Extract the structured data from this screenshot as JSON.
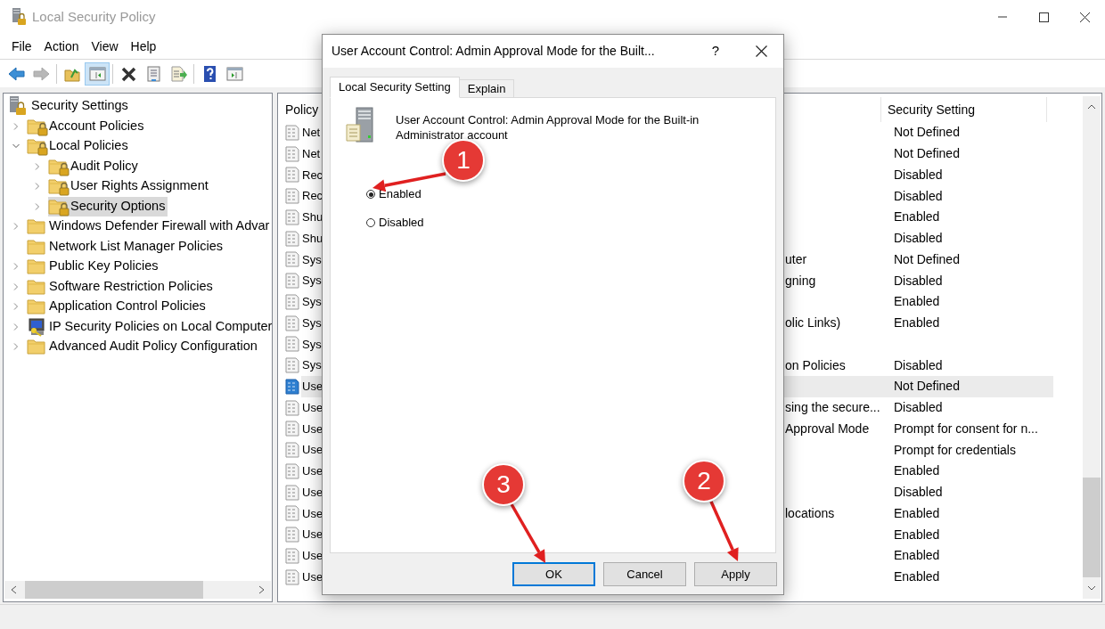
{
  "window": {
    "title": "Local Security Policy"
  },
  "menu": [
    "File",
    "Action",
    "View",
    "Help"
  ],
  "toolbar": [
    {
      "kind": "back",
      "disabled": false,
      "pressed": false
    },
    {
      "kind": "forward",
      "disabled": true,
      "pressed": false
    },
    {
      "kind": "separator"
    },
    {
      "kind": "up",
      "disabled": false,
      "pressed": false
    },
    {
      "kind": "console-tree",
      "disabled": false,
      "pressed": true
    },
    {
      "kind": "separator"
    },
    {
      "kind": "delete",
      "disabled": false,
      "pressed": false
    },
    {
      "kind": "properties",
      "disabled": false,
      "pressed": false
    },
    {
      "kind": "export",
      "disabled": false,
      "pressed": false
    },
    {
      "kind": "separator"
    },
    {
      "kind": "help",
      "disabled": false,
      "pressed": false
    },
    {
      "kind": "action-pane",
      "disabled": false,
      "pressed": false
    }
  ],
  "tree": {
    "label": "Security Settings",
    "children": [
      {
        "label": "Account Policies",
        "kind": "locked-folder",
        "expanded": false,
        "selected": false
      },
      {
        "label": "Local Policies",
        "kind": "locked-folder",
        "expanded": true,
        "selected": false,
        "children": [
          {
            "label": "Audit Policy",
            "kind": "locked-folder",
            "expanded": false,
            "selected": false
          },
          {
            "label": "User Rights Assignment",
            "kind": "locked-folder",
            "expanded": false,
            "selected": false
          },
          {
            "label": "Security Options",
            "kind": "locked-folder",
            "expanded": false,
            "selected": true
          }
        ]
      },
      {
        "label": "Windows Defender Firewall with Advar",
        "kind": "folder",
        "expanded": false,
        "selected": false
      },
      {
        "label": "Network List Manager Policies",
        "kind": "folder",
        "selected": false
      },
      {
        "label": "Public Key Policies",
        "kind": "folder",
        "expanded": false,
        "selected": false
      },
      {
        "label": "Software Restriction Policies",
        "kind": "folder",
        "expanded": false,
        "selected": false
      },
      {
        "label": "Application Control Policies",
        "kind": "folder",
        "expanded": false,
        "selected": false
      },
      {
        "label": "IP Security Policies on Local Computer",
        "kind": "computer",
        "expanded": false,
        "selected": false
      },
      {
        "label": "Advanced Audit Policy Configuration",
        "kind": "folder",
        "expanded": false,
        "selected": false
      }
    ]
  },
  "policy_list": {
    "columns": [
      "Policy",
      "Security Setting"
    ],
    "rows": [
      {
        "policy_start": "Net",
        "setting": "Not Defined",
        "selected": false
      },
      {
        "policy_start": "Net",
        "setting": "Not Defined",
        "selected": false
      },
      {
        "policy_start": "Rec",
        "setting": "Disabled",
        "selected": false
      },
      {
        "policy_start": "Rec",
        "setting": "Disabled",
        "selected": false
      },
      {
        "policy_start": "Shu",
        "setting": "Enabled",
        "selected": false
      },
      {
        "policy_start": "Shu",
        "setting": "Disabled",
        "selected": false
      },
      {
        "policy_start": "Sys",
        "policy_end": "uter",
        "setting": "Not Defined",
        "selected": false
      },
      {
        "policy_start": "Sys",
        "policy_end": "gning",
        "setting": "Disabled",
        "selected": false
      },
      {
        "policy_start": "Sys",
        "setting": "Enabled",
        "selected": false
      },
      {
        "policy_start": "Sys",
        "policy_end": "olic Links)",
        "setting": "Enabled",
        "selected": false
      },
      {
        "policy_start": "Sys",
        "selected": false
      },
      {
        "policy_start": "Sys",
        "policy_end": "on Policies",
        "setting": "Disabled",
        "selected": false
      },
      {
        "policy_start": "Use",
        "setting": "Not Defined",
        "selected": true
      },
      {
        "policy_start": "Use",
        "policy_end": "sing the secure...",
        "setting": "Disabled",
        "selected": false
      },
      {
        "policy_start": "Use",
        "policy_end": "Approval Mode",
        "setting": "Prompt for consent for n...",
        "selected": false
      },
      {
        "policy_start": "Use",
        "setting": "Prompt for credentials",
        "selected": false
      },
      {
        "policy_start": "Use",
        "setting": "Enabled",
        "selected": false
      },
      {
        "policy_start": "Use",
        "setting": "Disabled",
        "selected": false
      },
      {
        "policy_start": "Use",
        "policy_end": "locations",
        "setting": "Enabled",
        "selected": false
      },
      {
        "policy_start": "Use",
        "setting": "Enabled",
        "selected": false
      },
      {
        "policy_start": "Use",
        "setting": "Enabled",
        "selected": false
      },
      {
        "policy_start": "Use",
        "setting": "Enabled",
        "selected": false
      }
    ]
  },
  "dialog": {
    "title": "User Account Control: Admin Approval Mode for the Built...",
    "help": "?",
    "tabs": [
      {
        "label": "Local Security Setting",
        "selected": true
      },
      {
        "label": "Explain",
        "selected": false
      }
    ],
    "description": "User Account Control: Admin Approval Mode for the Built-in Administrator account",
    "options": [
      {
        "label": "Enabled",
        "selected": true
      },
      {
        "label": "Disabled",
        "selected": false
      }
    ],
    "buttons": [
      {
        "label": "OK",
        "default": true
      },
      {
        "label": "Cancel",
        "default": false
      },
      {
        "label": "Apply",
        "default": false
      }
    ]
  },
  "annotations": [
    {
      "number": "1"
    },
    {
      "number": "2"
    },
    {
      "number": "3"
    }
  ]
}
